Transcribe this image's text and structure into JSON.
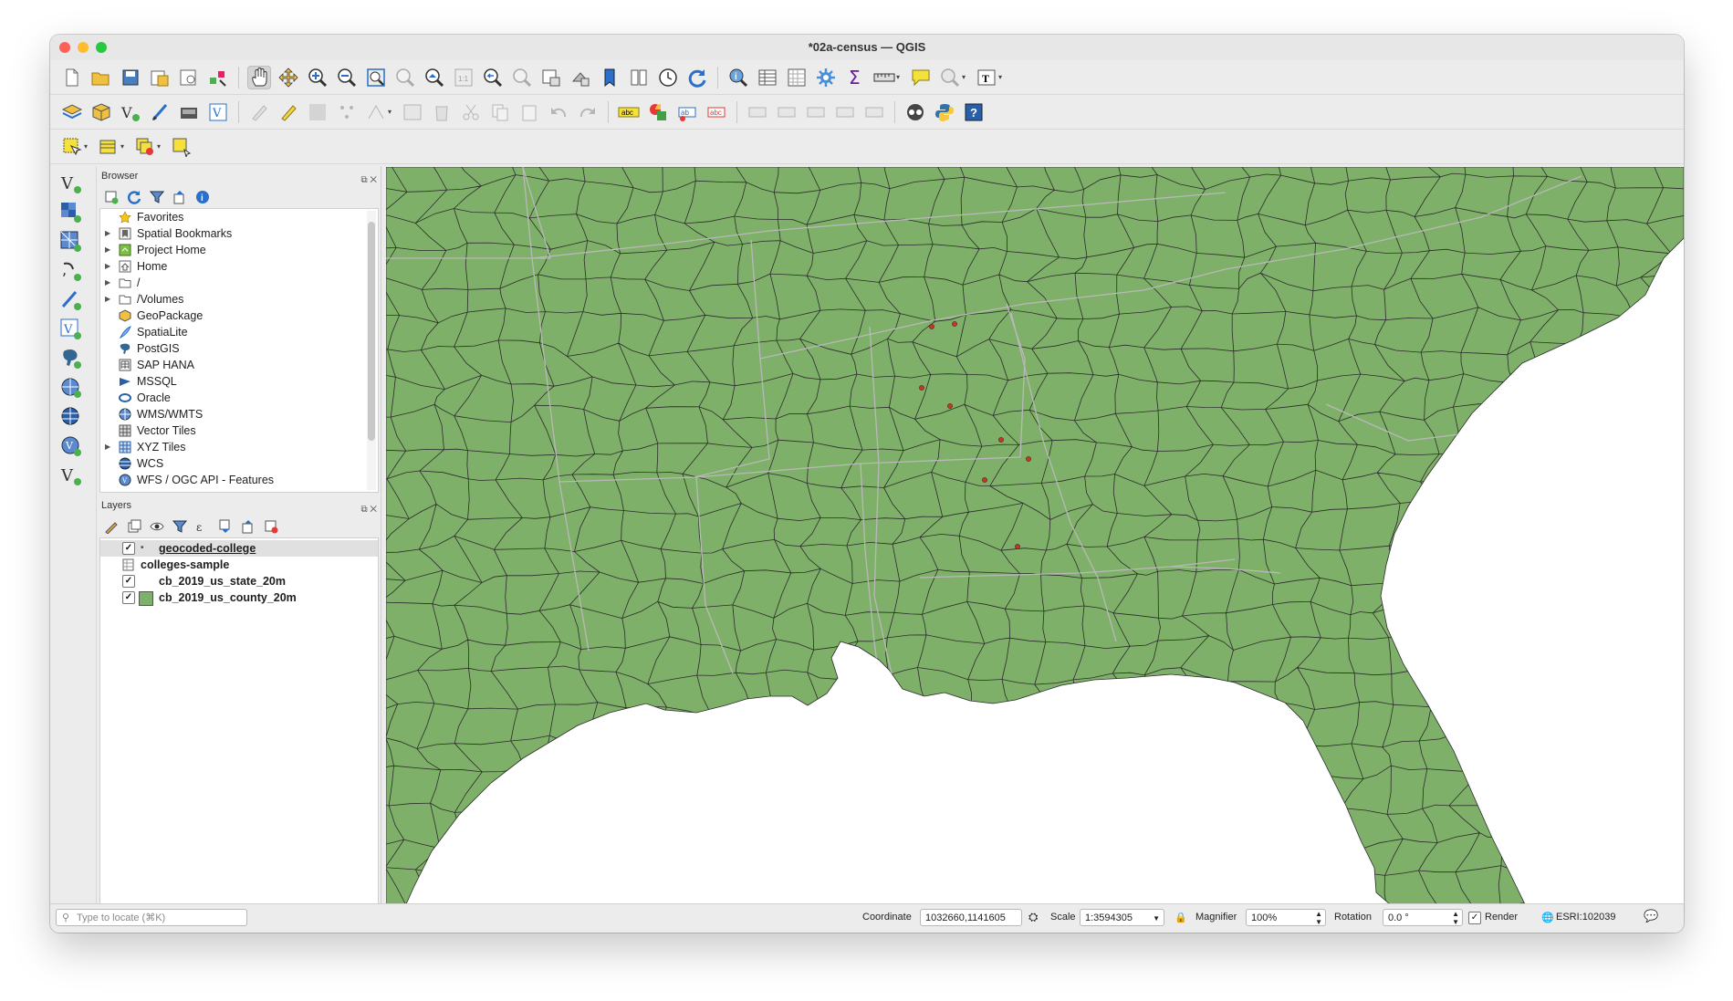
{
  "window": {
    "title": "*02a-census — QGIS",
    "traffic_colors": [
      "#fe5f57",
      "#febc2e",
      "#28c840"
    ]
  },
  "toolbars": {
    "file": [
      "new-project-icon",
      "open-project-icon",
      "save-project-icon",
      "save-as-icon",
      "print-layout-icon",
      "style-manager-icon"
    ],
    "navigation": [
      "pan-icon",
      "pan-to-selection-icon",
      "zoom-in-icon",
      "zoom-out-icon",
      "zoom-full-icon",
      "zoom-selection-icon",
      "zoom-layer-icon",
      "zoom-native-icon",
      "zoom-last-icon",
      "zoom-next-icon",
      "new-map-view-icon",
      "new-3d-view-icon",
      "bookmark-icon",
      "show-bookmarks-icon",
      "temporal-icon",
      "refresh-icon"
    ],
    "attributes": [
      "identify-icon",
      "attribute-table-icon",
      "field-calc-icon",
      "processing-icon",
      "statistics-icon",
      "measure-icon",
      "map-tips-icon",
      "annotation-icon",
      "text-annotation-icon"
    ],
    "digitizing": [
      "add-vector-layer-icon",
      "add-raster-layer-icon",
      "add-delimited-icon",
      "add-spatialite-icon",
      "add-virtual-icon",
      "add-wms-icon"
    ]
  },
  "browser": {
    "title": "Browser",
    "items": [
      {
        "label": "Favorites",
        "icon": "star-icon",
        "expand": false
      },
      {
        "label": "Spatial Bookmarks",
        "icon": "bookmark-icon",
        "expand": true
      },
      {
        "label": "Project Home",
        "icon": "project-home-icon",
        "expand": true
      },
      {
        "label": "Home",
        "icon": "home-icon",
        "expand": true
      },
      {
        "label": "/",
        "icon": "folder-icon",
        "expand": true
      },
      {
        "label": "/Volumes",
        "icon": "folder-icon",
        "expand": true
      },
      {
        "label": "GeoPackage",
        "icon": "geopackage-icon",
        "expand": false
      },
      {
        "label": "SpatiaLite",
        "icon": "spatialite-icon",
        "expand": false
      },
      {
        "label": "PostGIS",
        "icon": "postgis-icon",
        "expand": false
      },
      {
        "label": "SAP HANA",
        "icon": "sap-hana-icon",
        "expand": false
      },
      {
        "label": "MSSQL",
        "icon": "mssql-icon",
        "expand": false
      },
      {
        "label": "Oracle",
        "icon": "oracle-icon",
        "expand": false
      },
      {
        "label": "WMS/WMTS",
        "icon": "wms-icon",
        "expand": false
      },
      {
        "label": "Vector Tiles",
        "icon": "vector-tiles-icon",
        "expand": false
      },
      {
        "label": "XYZ Tiles",
        "icon": "xyz-tiles-icon",
        "expand": true
      },
      {
        "label": "WCS",
        "icon": "wcs-icon",
        "expand": false
      },
      {
        "label": "WFS / OGC API - Features",
        "icon": "wfs-icon",
        "expand": false
      }
    ]
  },
  "layers": {
    "title": "Layers",
    "items": [
      {
        "label": "geocoded-college",
        "checked": true,
        "symbol": "point",
        "selected": true
      },
      {
        "label": "colleges-sample",
        "checked": null,
        "symbol": "table",
        "selected": false
      },
      {
        "label": "cb_2019_us_state_20m",
        "checked": true,
        "symbol": "none",
        "selected": false
      },
      {
        "label": "cb_2019_us_county_20m",
        "checked": true,
        "symbol": "fill",
        "selected": false
      }
    ]
  },
  "map": {
    "land_color": "#7fb069",
    "county_line_color": "#2b2b2b",
    "state_line_color": "#b9b9b9",
    "point_color": "#c0392b",
    "water_color": "#ffffff"
  },
  "status": {
    "locator_placeholder": "Type to locate (⌘K)",
    "coordinate_label": "Coordinate",
    "coordinate_value": "1032660,1141605",
    "scale_label": "Scale",
    "scale_value": "1:3594305",
    "magnifier_label": "Magnifier",
    "magnifier_value": "100%",
    "rotation_label": "Rotation",
    "rotation_value": "0.0 °",
    "render_label": "Render",
    "crs_label": "ESRI:102039"
  }
}
